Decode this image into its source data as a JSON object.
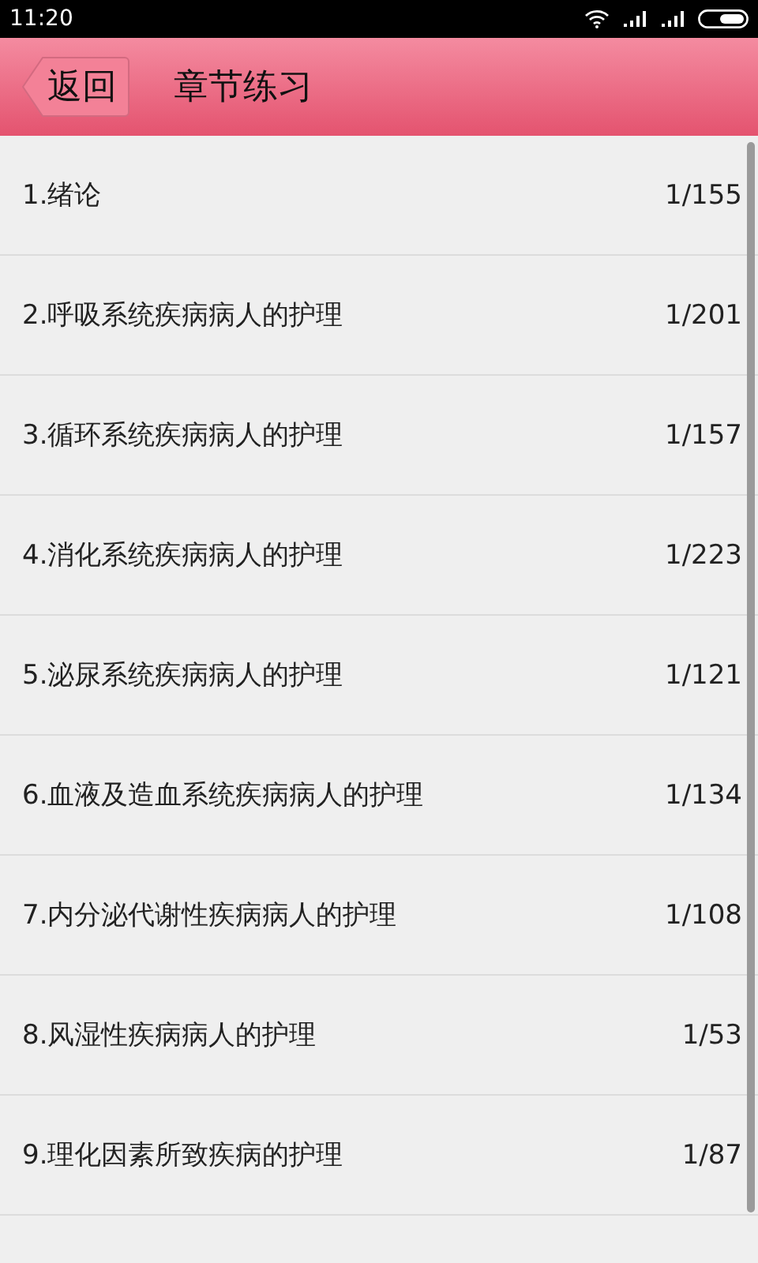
{
  "status_bar": {
    "time": "11:20"
  },
  "header": {
    "back": "返回",
    "title": "章节练习"
  },
  "chapters": [
    {
      "name": "1.绪论",
      "progress": "1/155"
    },
    {
      "name": "2.呼吸系统疾病病人的护理",
      "progress": "1/201"
    },
    {
      "name": "3.循环系统疾病病人的护理",
      "progress": "1/157"
    },
    {
      "name": "4.消化系统疾病病人的护理",
      "progress": "1/223"
    },
    {
      "name": "5.泌尿系统疾病病人的护理",
      "progress": "1/121"
    },
    {
      "name": "6.血液及造血系统疾病病人的护理",
      "progress": "1/134"
    },
    {
      "name": "7.内分泌代谢性疾病病人的护理",
      "progress": "1/108"
    },
    {
      "name": "8.风湿性疾病病人的护理",
      "progress": "1/53"
    },
    {
      "name": "9.理化因素所致疾病的护理",
      "progress": "1/87"
    }
  ]
}
